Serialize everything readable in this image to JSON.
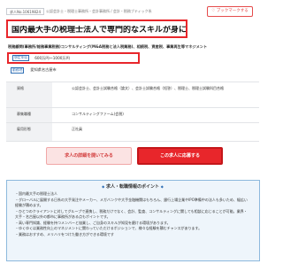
{
  "header": {
    "job_id": "求人No.10619824",
    "breadcrumb": "公認会計士・税理士事務所・会計事務所 / 会計・税務ブティック系",
    "bookmark_label": "♡ ブックマークする"
  },
  "job": {
    "title": "国内最大手の税理士法人で専門的なスキルが身に付きます",
    "subtitle": "税務顧問(事務所/総務事業税務)コンサルティング(M&A税務と法人税業務)、相続税、資産税、事業再生等マネジメント",
    "salary_label": "想定年収",
    "salary": "600万円～1000万円",
    "location_label": "勤務地",
    "location": "愛知県名古屋市"
  },
  "info_table": [
    {
      "head": "資格",
      "value": "公認会計士、会計士試験合格（論文）、会計士試験合格（短答）、税理士、税理士試験科目合格"
    },
    {
      "head": "募集職種",
      "value": "コンサルティングファーム(会税)"
    },
    {
      "head": "雇用形態",
      "value": "正社員"
    }
  ],
  "actions": {
    "detail_label": "求人の詳細を開いてみる",
    "apply_label": "この求人に応募する"
  },
  "points": {
    "title": "求人・転職情報のポイント",
    "lines": [
      "・国内最大手の税理士法人",
      "・グローバルに展開する日系の大手発注やメーカー、メガバンクや大手金融機関はもちろん、銀行上場企業やIPO準備中の法人も多いため、幅広い経験が積めます。",
      "・ひとつのクライアントに対してグループで連携し、税務だけでなく、会計、監査、コンサルティングに関しても相談に応じることが可能。業界・大手・名古屋以外の都市に事務所がある点もポイントです。",
      "・高い専門知識、経験を持つメンバーと協業し、ご自身のスキルが知見を磨ける環境があります。",
      "・ゆくゆくは業務性向上のマネジメントに関わっていただけるポジションで、様々な経験を積むチャンスがあります。",
      "・業務はおすすめ、メリハリをつけた働き方ができる環境です"
    ]
  }
}
